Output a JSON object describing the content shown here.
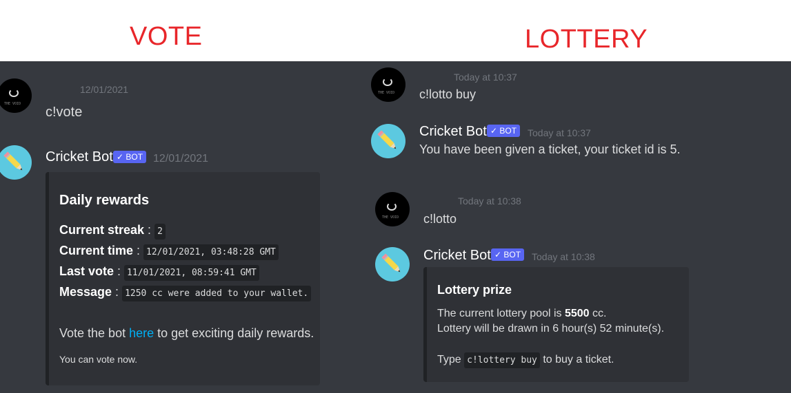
{
  "headers": {
    "vote": "VOTE",
    "lottery": "LOTTERY"
  },
  "colors": {
    "header": "#e8262a",
    "chat_bg": "#36393f",
    "embed_bg": "#2f3136",
    "bot_badge": "#5865f2",
    "link": "#00aff4"
  },
  "vote": {
    "user_msg": {
      "avatar_icon": "user-avatar-icon",
      "timestamp": "12/01/2021",
      "text": "c!vote"
    },
    "bot_msg": {
      "avatar_icon": "pencil-avatar-icon",
      "name": "Cricket Bot",
      "badge": "✓ BOT",
      "timestamp": "12/01/2021",
      "embed": {
        "title": "Daily rewards",
        "fields": [
          {
            "label": "Current streak",
            "sep": " : ",
            "value": "2"
          },
          {
            "label": "Current time",
            "sep": " : ",
            "value": "12/01/2021, 03:48:28 GMT"
          },
          {
            "label": "Last vote",
            "sep": " : ",
            "value": "11/01/2021, 08:59:41 GMT"
          },
          {
            "label": "Message",
            "sep": " : ",
            "value": "1250 cc were added to your wallet."
          }
        ],
        "vote_pre": "Vote the bot ",
        "vote_link": "here",
        "vote_post": " to get exciting daily rewards.",
        "footer": "You can vote now."
      }
    }
  },
  "lottery": {
    "msg1": {
      "timestamp": "Today at 10:37",
      "text": "c!lotto buy"
    },
    "msg2": {
      "name": "Cricket Bot",
      "badge": "✓ BOT",
      "timestamp": "Today at 10:37",
      "text": "You have been given a ticket, your ticket id is 5."
    },
    "msg3": {
      "timestamp": "Today at 10:38",
      "text": "c!lotto"
    },
    "msg4": {
      "name": "Cricket Bot",
      "badge": "✓ BOT",
      "timestamp": "Today at 10:38",
      "embed": {
        "title": "Lottery prize",
        "pool_pre": "The current lottery pool is ",
        "pool_value": "5500",
        "pool_post": " cc.",
        "draw_line": "Lottery will be drawn in 6 hour(s) 52 minute(s).",
        "type_pre": "Type ",
        "type_code": "c!lottery buy",
        "type_post": " to buy a ticket."
      }
    }
  }
}
